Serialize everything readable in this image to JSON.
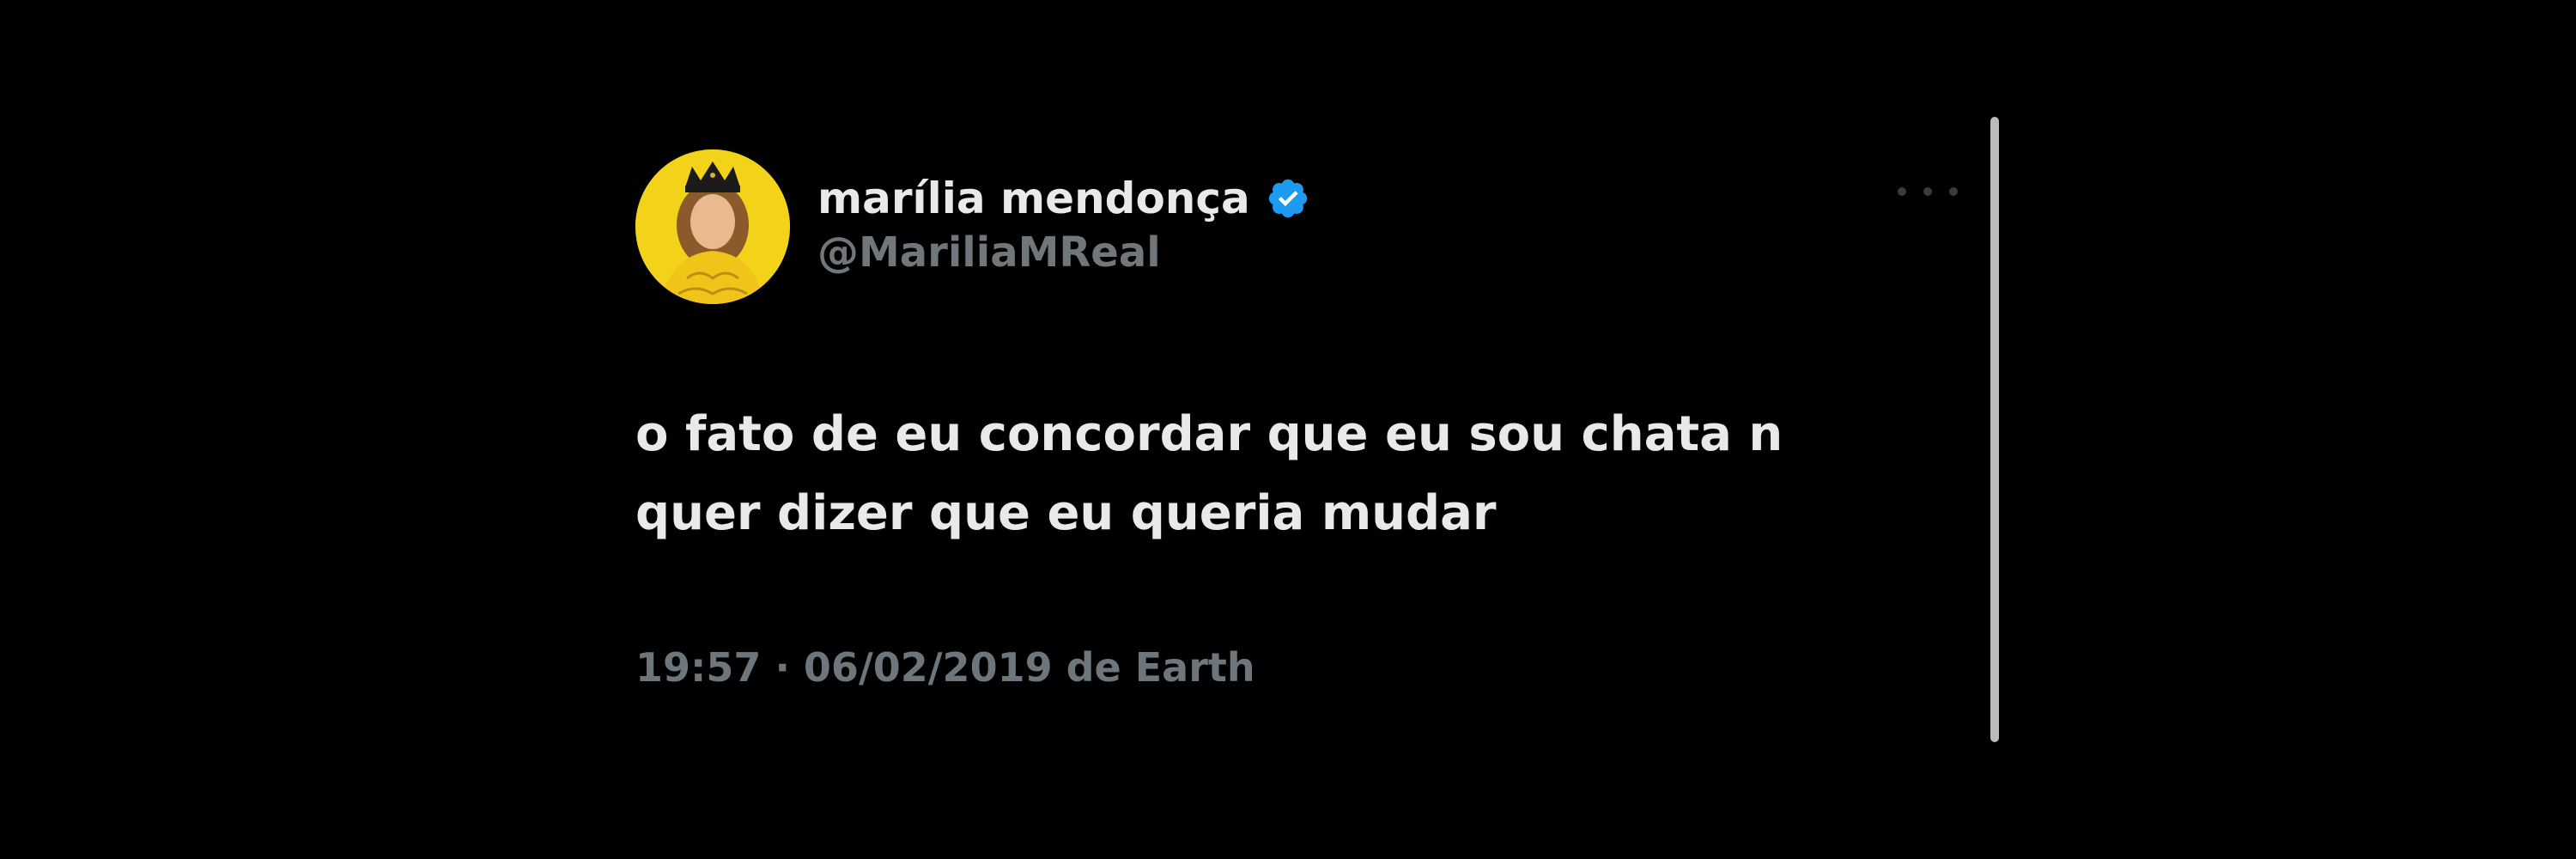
{
  "tweet": {
    "author": {
      "display_name": "marília mendonça",
      "handle": "@MariliaMReal",
      "verified": true,
      "avatar_icon": "avatar-photo"
    },
    "text": "o fato de eu concordar que eu sou chata n\nquer dizer que eu queria mudar",
    "meta": "19:57 · 06/02/2019 de Earth",
    "more_icon": "more-options-icon"
  },
  "colors": {
    "background": "#000000",
    "text_primary": "#e7e9ea",
    "text_secondary": "#71767b",
    "verified_badge": "#1d9bf0",
    "avatar_bg": "#f3d31a"
  }
}
